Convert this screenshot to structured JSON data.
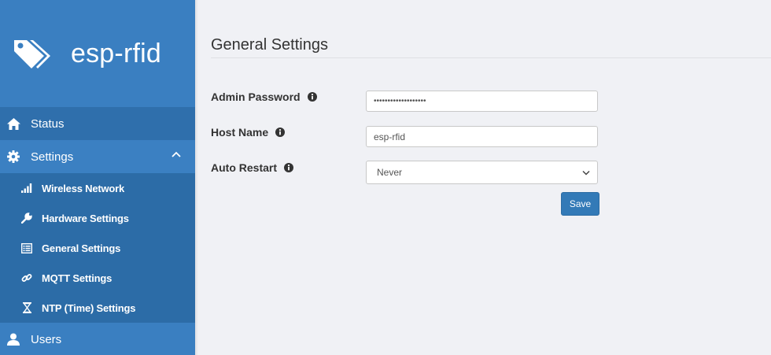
{
  "brand": {
    "name": "esp-rfid"
  },
  "sidebar": {
    "status_label": "Status",
    "settings_label": "Settings",
    "users_label": "Users",
    "settings_items": [
      {
        "label": "Wireless Network"
      },
      {
        "label": "Hardware Settings"
      },
      {
        "label": "General Settings"
      },
      {
        "label": "MQTT Settings"
      },
      {
        "label": "NTP (Time) Settings"
      }
    ]
  },
  "main": {
    "title": "General Settings",
    "admin_password": {
      "label": "Admin Password",
      "value": "•••••••••••••••••••"
    },
    "host_name": {
      "label": "Host Name",
      "value": "esp-rfid"
    },
    "auto_restart": {
      "label": "Auto Restart",
      "value": "Never"
    },
    "save_label": "Save"
  },
  "colors": {
    "sidebar": "#3a7fc1",
    "sidebar_active": "#2f6fac",
    "submenu": "#2c6ca7",
    "button": "#337ab7",
    "background": "#f0f1f5"
  }
}
